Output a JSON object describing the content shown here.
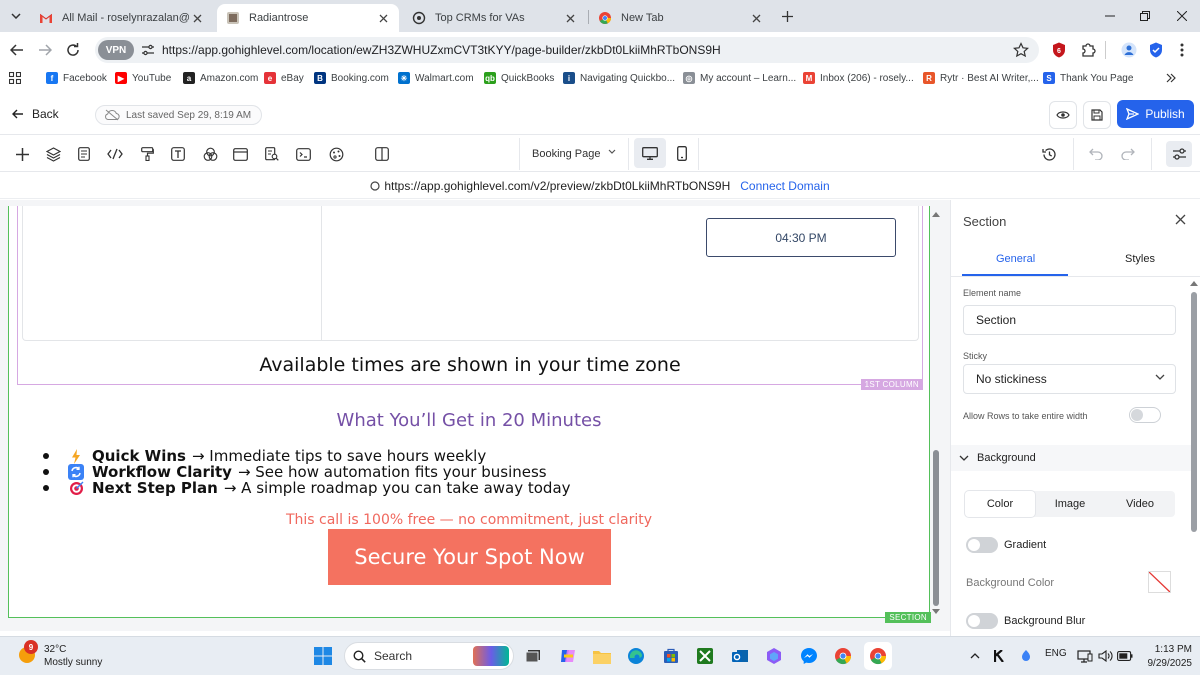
{
  "browser": {
    "tabs": [
      {
        "title": "All Mail - roselynrazalan@gmail",
        "icon": "gmail-icon",
        "active": false
      },
      {
        "title": "Radiantrose",
        "icon": "radiantrose-icon",
        "active": true
      },
      {
        "title": "Top CRMs for VAs",
        "icon": "openai-icon",
        "active": false
      },
      {
        "title": "New Tab",
        "icon": "chrome-icon",
        "active": false
      }
    ],
    "vpn_label": "VPN",
    "url": "https://app.gohighlevel.com/location/ewZH3ZWHUZxmCVT3tKYY/page-builder/zkbDt0LkiiMhRTbONS9H",
    "bookmarks": [
      {
        "label": "Facebook",
        "color": "#1877f2",
        "glyph": "f"
      },
      {
        "label": "YouTube",
        "color": "#ff0000",
        "glyph": "▶"
      },
      {
        "label": "Amazon.com",
        "color": "#222222",
        "glyph": "a"
      },
      {
        "label": "eBay",
        "color": "#e53238",
        "glyph": "e"
      },
      {
        "label": "Booking.com",
        "color": "#003580",
        "glyph": "B"
      },
      {
        "label": "Walmart.com",
        "color": "#0071ce",
        "glyph": "✳"
      },
      {
        "label": "QuickBooks",
        "color": "#2ca01c",
        "glyph": "qb"
      },
      {
        "label": "Navigating Quickbo...",
        "color": "#1a4e8a",
        "glyph": "i"
      },
      {
        "label": "My account – Learn...",
        "color": "#8a8f96",
        "glyph": "◎"
      },
      {
        "label": "Inbox (206) - rosely...",
        "color": "#ea4335",
        "glyph": "M"
      },
      {
        "label": "Rytr · Best AI Writer,...",
        "color": "#e8562a",
        "glyph": "R"
      },
      {
        "label": "Thank You Page",
        "color": "#2563eb",
        "glyph": "S"
      }
    ]
  },
  "builder": {
    "back_label": "Back",
    "last_saved": "Last saved Sep 29, 8:19 AM",
    "publish_label": "Publish",
    "page_select": "Booking Page",
    "preview_url": "https://app.gohighlevel.com/v2/preview/zkbDt0LkiiMhRTbONS9H",
    "connect_domain": "Connect Domain"
  },
  "canvas": {
    "time_slot": "04:30 PM",
    "timezone_note": "Available times are shown in your time zone",
    "column_badge": "1ST COLUMN",
    "subheading": "What You’ll Get in 20 Minutes",
    "bullets": [
      {
        "emoji_color": "#f5a623",
        "glyph": "⚡",
        "bold": "Quick Wins",
        "text": "→ Immediate tips to save hours weekly"
      },
      {
        "emoji_color": "#3b82f6",
        "glyph": "🔄",
        "bold": "Workflow Clarity",
        "text": "→ See how automation fits your business"
      },
      {
        "emoji_color": "#e11d48",
        "glyph": "◎",
        "bold": "Next Step Plan",
        "text": "→ A simple roadmap you can take away today"
      }
    ],
    "free_note": "This call is 100% free — no commitment, just clarity",
    "cta_label": "Secure Your Spot Now",
    "section_badge": "SECTION"
  },
  "panel": {
    "title": "Section",
    "tabs": [
      "General",
      "Styles"
    ],
    "element_name_label": "Element name",
    "element_name_value": "Section",
    "sticky_label": "Sticky",
    "sticky_value": "No stickiness",
    "allow_rows_label": "Allow Rows to take entire width",
    "background_label": "Background",
    "bg_tabs": [
      "Color",
      "Image",
      "Video"
    ],
    "gradient_label": "Gradient",
    "bg_color_label": "Background Color",
    "bg_blur_label": "Background Blur"
  },
  "taskbar": {
    "temperature": "32°C",
    "weather": "Mostly sunny",
    "weather_badge": "9",
    "search_placeholder": "Search",
    "language": "ENG",
    "time": "1:13 PM",
    "date": "9/29/2025"
  }
}
